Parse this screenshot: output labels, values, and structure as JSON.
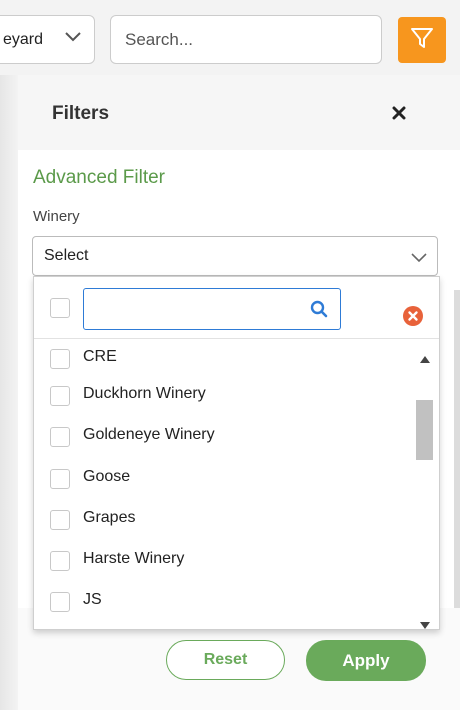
{
  "toolbar": {
    "vineyard_select_text": "eyard",
    "search_placeholder": "Search...",
    "filter_icon": "filter-funnel-icon"
  },
  "panel": {
    "title": "Filters",
    "close_icon": "close-x-icon",
    "advanced_filter_title": "Advanced Filter",
    "winery_label": "Winery",
    "winery_select_value": "Select",
    "reset_label": "Reset",
    "apply_label": "Apply"
  },
  "winery_dropdown": {
    "search_value": "",
    "items": [
      {
        "label": "CRE",
        "checked": false
      },
      {
        "label": "Duckhorn Winery",
        "checked": false
      },
      {
        "label": "Goldeneye Winery",
        "checked": false
      },
      {
        "label": "Goose",
        "checked": false
      },
      {
        "label": "Grapes",
        "checked": false
      },
      {
        "label": "Harste Winery",
        "checked": false
      },
      {
        "label": "JS",
        "checked": false
      }
    ]
  },
  "colors": {
    "accent_orange": "#f7961e",
    "accent_green": "#6aaa5b",
    "heading_green": "#5b9a4a",
    "focus_blue": "#2e7bd6",
    "clear_red": "#e8623a"
  }
}
